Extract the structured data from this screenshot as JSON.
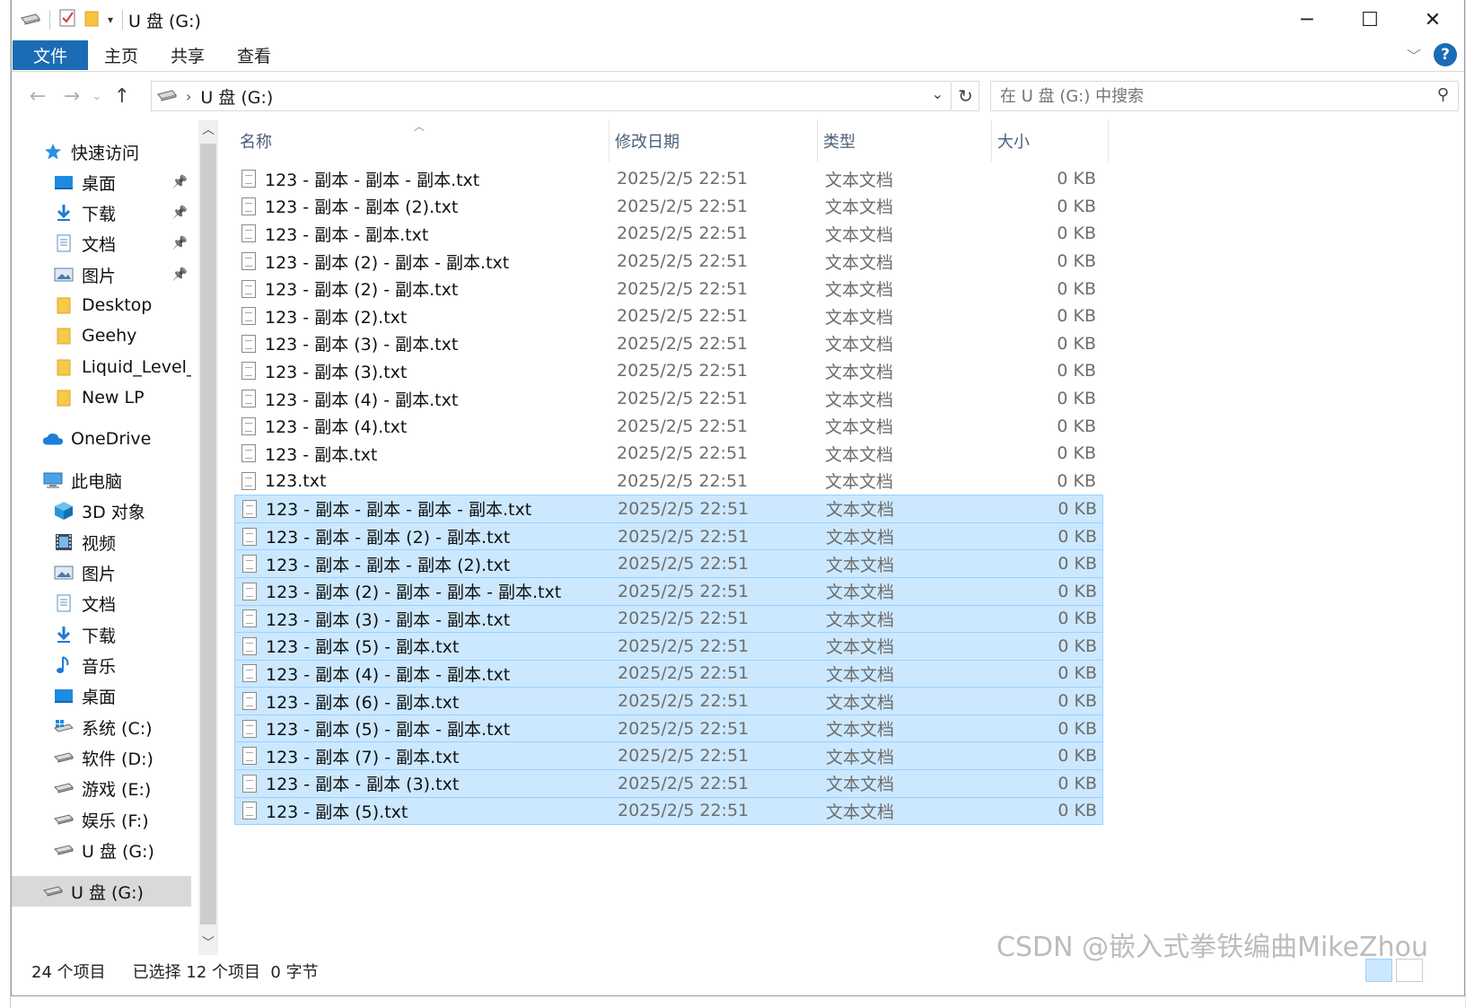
{
  "window": {
    "title": "U 盘 (G:)",
    "controls": {
      "minimize": "─",
      "maximize": "☐",
      "close": "✕"
    }
  },
  "ribbon": {
    "tabs": [
      "文件",
      "主页",
      "共享",
      "查看"
    ]
  },
  "address": {
    "path": "U 盘 (G:)",
    "search_placeholder": "在 U 盘 (G:) 中搜索"
  },
  "sidebar": {
    "items": [
      {
        "label": "快速访问",
        "icon": "star-icon",
        "indent": 0,
        "pinned": false
      },
      {
        "label": "桌面",
        "icon": "desktop-icon",
        "indent": 1,
        "pinned": true
      },
      {
        "label": "下载",
        "icon": "download-icon",
        "indent": 1,
        "pinned": true
      },
      {
        "label": "文档",
        "icon": "document-icon",
        "indent": 1,
        "pinned": true
      },
      {
        "label": "图片",
        "icon": "pictures-icon",
        "indent": 1,
        "pinned": true
      },
      {
        "label": "Desktop",
        "icon": "folder-icon",
        "indent": 1,
        "pinned": false
      },
      {
        "label": "Geehy",
        "icon": "folder-icon",
        "indent": 1,
        "pinned": false
      },
      {
        "label": "Liquid_Level_M",
        "icon": "folder-icon",
        "indent": 1,
        "pinned": false
      },
      {
        "label": "New LP",
        "icon": "folder-icon",
        "indent": 1,
        "pinned": false
      },
      {
        "label": "OneDrive",
        "icon": "cloud-icon",
        "indent": 0,
        "pinned": false
      },
      {
        "label": "此电脑",
        "icon": "computer-icon",
        "indent": 0,
        "pinned": false
      },
      {
        "label": "3D 对象",
        "icon": "cube-icon",
        "indent": 1,
        "pinned": false
      },
      {
        "label": "视频",
        "icon": "video-icon",
        "indent": 1,
        "pinned": false
      },
      {
        "label": "图片",
        "icon": "pictures-icon",
        "indent": 1,
        "pinned": false
      },
      {
        "label": "文档",
        "icon": "document-icon",
        "indent": 1,
        "pinned": false
      },
      {
        "label": "下载",
        "icon": "download-icon",
        "indent": 1,
        "pinned": false
      },
      {
        "label": "音乐",
        "icon": "music-icon",
        "indent": 1,
        "pinned": false
      },
      {
        "label": "桌面",
        "icon": "desktop-icon",
        "indent": 1,
        "pinned": false
      },
      {
        "label": "系统 (C:)",
        "icon": "windows-drive-icon",
        "indent": 1,
        "pinned": false
      },
      {
        "label": "软件 (D:)",
        "icon": "drive-icon",
        "indent": 1,
        "pinned": false
      },
      {
        "label": "游戏 (E:)",
        "icon": "drive-icon",
        "indent": 1,
        "pinned": false
      },
      {
        "label": "娱乐 (F:)",
        "icon": "drive-icon",
        "indent": 1,
        "pinned": false
      },
      {
        "label": "U 盘 (G:)",
        "icon": "usb-drive-icon",
        "indent": 1,
        "pinned": false
      },
      {
        "label": "U 盘 (G:)",
        "icon": "usb-drive-icon",
        "indent": 0,
        "pinned": false,
        "selected": true
      }
    ]
  },
  "columns": {
    "name": "名称",
    "date": "修改日期",
    "type": "类型",
    "size": "大小"
  },
  "files": [
    {
      "name": "123 - 副本 - 副本 - 副本.txt",
      "date": "2025/2/5 22:51",
      "type": "文本文档",
      "size": "0 KB",
      "selected": false
    },
    {
      "name": "123 - 副本 - 副本 (2).txt",
      "date": "2025/2/5 22:51",
      "type": "文本文档",
      "size": "0 KB",
      "selected": false
    },
    {
      "name": "123 - 副本 - 副本.txt",
      "date": "2025/2/5 22:51",
      "type": "文本文档",
      "size": "0 KB",
      "selected": false
    },
    {
      "name": "123 - 副本 (2) - 副本 - 副本.txt",
      "date": "2025/2/5 22:51",
      "type": "文本文档",
      "size": "0 KB",
      "selected": false
    },
    {
      "name": "123 - 副本 (2) - 副本.txt",
      "date": "2025/2/5 22:51",
      "type": "文本文档",
      "size": "0 KB",
      "selected": false
    },
    {
      "name": "123 - 副本 (2).txt",
      "date": "2025/2/5 22:51",
      "type": "文本文档",
      "size": "0 KB",
      "selected": false
    },
    {
      "name": "123 - 副本 (3) - 副本.txt",
      "date": "2025/2/5 22:51",
      "type": "文本文档",
      "size": "0 KB",
      "selected": false
    },
    {
      "name": "123 - 副本 (3).txt",
      "date": "2025/2/5 22:51",
      "type": "文本文档",
      "size": "0 KB",
      "selected": false
    },
    {
      "name": "123 - 副本 (4) - 副本.txt",
      "date": "2025/2/5 22:51",
      "type": "文本文档",
      "size": "0 KB",
      "selected": false
    },
    {
      "name": "123 - 副本 (4).txt",
      "date": "2025/2/5 22:51",
      "type": "文本文档",
      "size": "0 KB",
      "selected": false
    },
    {
      "name": "123 - 副本.txt",
      "date": "2025/2/5 22:51",
      "type": "文本文档",
      "size": "0 KB",
      "selected": false
    },
    {
      "name": "123.txt",
      "date": "2025/2/5 22:51",
      "type": "文本文档",
      "size": "0 KB",
      "selected": false
    },
    {
      "name": "123 - 副本 - 副本 - 副本 - 副本.txt",
      "date": "2025/2/5 22:51",
      "type": "文本文档",
      "size": "0 KB",
      "selected": true
    },
    {
      "name": "123 - 副本 - 副本 (2) - 副本.txt",
      "date": "2025/2/5 22:51",
      "type": "文本文档",
      "size": "0 KB",
      "selected": true
    },
    {
      "name": "123 - 副本 - 副本 - 副本 (2).txt",
      "date": "2025/2/5 22:51",
      "type": "文本文档",
      "size": "0 KB",
      "selected": true
    },
    {
      "name": "123 - 副本 (2) - 副本 - 副本 - 副本.txt",
      "date": "2025/2/5 22:51",
      "type": "文本文档",
      "size": "0 KB",
      "selected": true
    },
    {
      "name": "123 - 副本 (3) - 副本 - 副本.txt",
      "date": "2025/2/5 22:51",
      "type": "文本文档",
      "size": "0 KB",
      "selected": true
    },
    {
      "name": "123 - 副本 (5) - 副本.txt",
      "date": "2025/2/5 22:51",
      "type": "文本文档",
      "size": "0 KB",
      "selected": true
    },
    {
      "name": "123 - 副本 (4) - 副本 - 副本.txt",
      "date": "2025/2/5 22:51",
      "type": "文本文档",
      "size": "0 KB",
      "selected": true
    },
    {
      "name": "123 - 副本 (6) - 副本.txt",
      "date": "2025/2/5 22:51",
      "type": "文本文档",
      "size": "0 KB",
      "selected": true
    },
    {
      "name": "123 - 副本 (5) - 副本 - 副本.txt",
      "date": "2025/2/5 22:51",
      "type": "文本文档",
      "size": "0 KB",
      "selected": true
    },
    {
      "name": "123 - 副本 (7) - 副本.txt",
      "date": "2025/2/5 22:51",
      "type": "文本文档",
      "size": "0 KB",
      "selected": true
    },
    {
      "name": "123 - 副本 - 副本 (3).txt",
      "date": "2025/2/5 22:51",
      "type": "文本文档",
      "size": "0 KB",
      "selected": true
    },
    {
      "name": "123 - 副本 (5).txt",
      "date": "2025/2/5 22:51",
      "type": "文本文档",
      "size": "0 KB",
      "selected": true
    }
  ],
  "status": {
    "item_count": "24 个项目",
    "selection": "已选择 12 个项目  0 字节"
  },
  "watermark": "CSDN @嵌入式拳铁编曲MikeZhou",
  "colors": {
    "accent": "#1b6cb5",
    "selection_bg": "#cce8ff",
    "selection_border": "#99d1ff"
  }
}
